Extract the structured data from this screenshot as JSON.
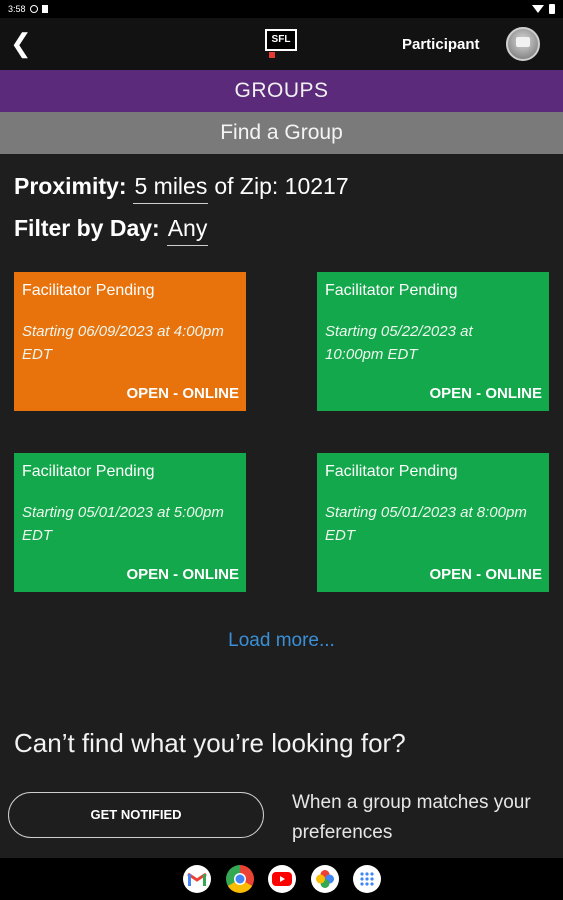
{
  "status_bar": {
    "time": "3:58"
  },
  "app_bar": {
    "logo_text": "SFL",
    "role": "Participant"
  },
  "groups_title": "GROUPS",
  "find_title": "Find a Group",
  "filters": {
    "proximity_label": "Proximity:",
    "proximity_value": "5 miles",
    "zip_text": "of Zip: 10217",
    "day_label": "Filter by Day:",
    "day_value": "Any"
  },
  "cards": [
    {
      "title": "Facilitator Pending",
      "start_line1": "Starting 06/09/2023 at 4:00pm",
      "start_line2": "EDT",
      "status": "OPEN - ONLINE",
      "color": "#e8720c"
    },
    {
      "title": "Facilitator Pending",
      "start_line1": "Starting 05/22/2023 at",
      "start_line2": "10:00pm  EDT",
      "status": "OPEN - ONLINE",
      "color": "#13a84b"
    },
    {
      "title": "Facilitator Pending",
      "start_line1": "Starting 05/01/2023 at 5:00pm",
      "start_line2": "EDT",
      "status": "OPEN - ONLINE",
      "color": "#13a84b"
    },
    {
      "title": "Facilitator Pending",
      "start_line1": "Starting 05/01/2023 at 8:00pm",
      "start_line2": "EDT",
      "status": "OPEN - ONLINE",
      "color": "#13a84b"
    }
  ],
  "load_more": "Load more...",
  "cant_find": "Can’t find what you’re looking for?",
  "notify_button": "GET NOTIFIED",
  "notify_desc": "When a group matches your preferences",
  "colors": {
    "purple_bar": "#5c2a7a",
    "gray_bar": "#7a7a7a",
    "link": "#3b8fd6"
  },
  "taskbar_icons": [
    "gmail-icon",
    "chrome-icon",
    "youtube-icon",
    "photos-icon",
    "apps-icon"
  ]
}
